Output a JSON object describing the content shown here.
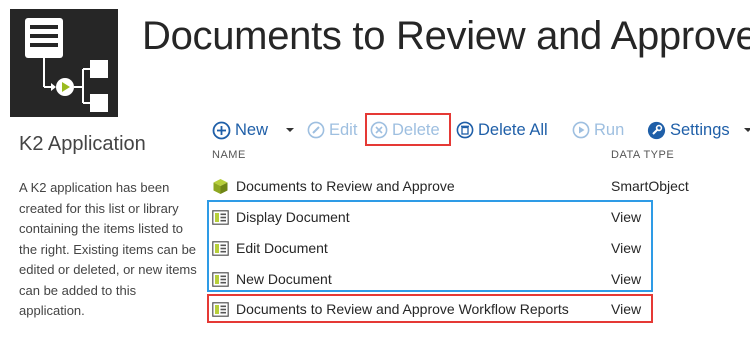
{
  "page": {
    "title": "Documents to Review and Approve"
  },
  "sidebar": {
    "heading": "K2 Application",
    "description": "A K2 application has been created for this list or library containing the items listed to the right. Existing items can be edited or deleted, or new items can be added to this application."
  },
  "toolbar": {
    "new_label": "New",
    "edit_label": "Edit",
    "delete_label": "Delete",
    "delete_all_label": "Delete All",
    "run_label": "Run",
    "settings_label": "Settings"
  },
  "table": {
    "headers": {
      "name": "NAME",
      "type": "DATA TYPE"
    },
    "rows": [
      {
        "name": "Documents to Review and Approve",
        "type": "SmartObject",
        "icon": "smartobject-icon"
      },
      {
        "name": "Display Document",
        "type": "View",
        "icon": "view-icon"
      },
      {
        "name": "Edit Document",
        "type": "View",
        "icon": "view-icon"
      },
      {
        "name": "New Document",
        "type": "View",
        "icon": "view-icon"
      },
      {
        "name": "Documents to Review and Approve Workflow Reports",
        "type": "View",
        "icon": "view-icon"
      }
    ]
  },
  "colors": {
    "accent": "#1f5fa8",
    "disabled": "#9ebfe0",
    "highlight_red": "#e53935",
    "highlight_blue": "#2e9be6",
    "logo_bg": "#262626"
  }
}
